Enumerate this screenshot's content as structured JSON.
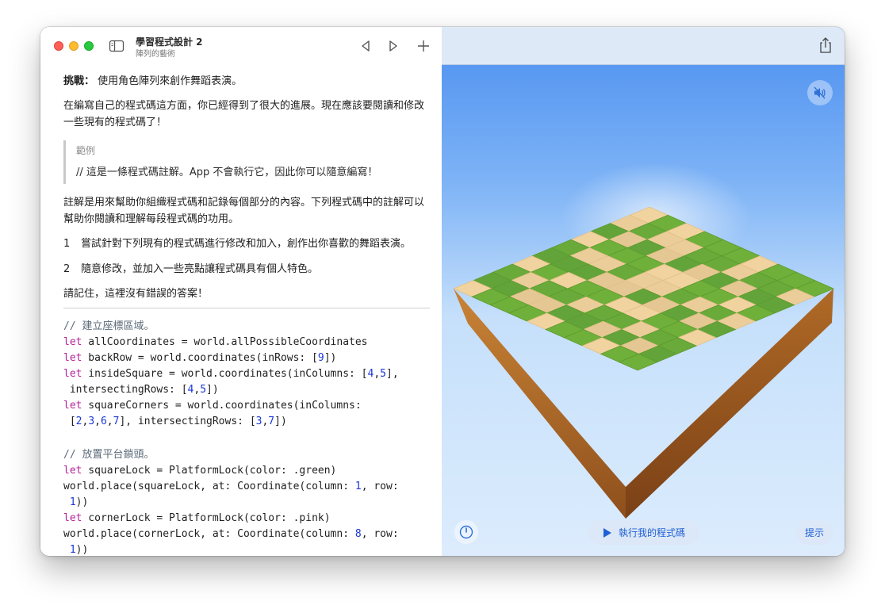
{
  "window": {
    "title": "學習程式設計 2",
    "subtitle": "陣列的藝術"
  },
  "instructions": {
    "challenge_label": "挑戰：",
    "challenge_text": " 使用角色陣列來創作舞蹈表演。",
    "intro": "在編寫自己的程式碼這方面，你已經得到了很大的進展。現在應該要閱讀和修改一些現有的程式碼了！",
    "example_label": "範例",
    "example_code": "//  這是一條程式碼註解。App  不會執行它，因此你可以隨意編寫！",
    "comment_explain": "註解是用來幫助你組織程式碼和記錄每個部分的內容。下列程式碼中的註解可以幫助你閱讀和理解每段程式碼的功用。",
    "steps": [
      {
        "num": "1",
        "text": "嘗試針對下列現有的程式碼進行修改和加入，創作出你喜歡的舞蹈表演。"
      },
      {
        "num": "2",
        "text": "隨意修改，並加入一些亮點讓程式碼具有個人特色。"
      }
    ],
    "reminder": "請記住，這裡沒有錯誤的答案！"
  },
  "code": {
    "comment1": "// 建立座標區域。",
    "let": "let",
    "line1": " allCoordinates = world.allPossibleCoordinates",
    "line2_a": " backRow = world.coordinates(inRows: [",
    "line2_n": "9",
    "line2_b": "])",
    "line3_a": " insideSquare = world.coordinates(inColumns: [",
    "line3_n1": "4",
    "line3_n2": "5",
    "line3_b": "],",
    "line4_a": " intersectingRows: [",
    "line4_n1": "4",
    "line4_n2": "5",
    "line4_b": "])",
    "line5": " squareCorners = world.coordinates(inColumns:",
    "line6_a": " [",
    "line6_n1": "2",
    "line6_n2": "3",
    "line6_n3": "6",
    "line6_n4": "7",
    "line6_b": "], intersectingRows: [",
    "line6_n5": "3",
    "line6_n6": "7",
    "line6_c": "])",
    "comment2": "// 放置平台鎖頭。",
    "line7": " squareLock = PlatformLock(color: .green)",
    "line8_a": "world.place(squareLock, at: Coordinate(column: ",
    "line8_n": "1",
    "line8_b": ", row:",
    "line9_n": "1",
    "line9_b": "))",
    "line10": " cornerLock = PlatformLock(color: .pink)",
    "line11_a": "world.place(cornerLock, at: Coordinate(column: ",
    "line11_n": "8",
    "line11_b": ", row:",
    "line12_n": "1",
    "line12_b": "))"
  },
  "controls": {
    "run_label": "執行我的程式碼",
    "hint_label": "提示"
  },
  "icons": {
    "sidebar": "sidebar-toggle-icon",
    "back": "chevron-left-icon",
    "forward": "chevron-right-icon",
    "add": "plus-icon",
    "share": "share-icon",
    "sound": "speaker-muted-icon",
    "speed": "speedometer-icon",
    "run": "play-icon"
  },
  "colors": {
    "keyword": "#b3239a",
    "number": "#1b36d6",
    "comment": "#5d6b7a",
    "accent": "#1f5fd6",
    "grass": "#6fb03a",
    "sand": "#f1d3a0",
    "dirt": "#b8712c"
  },
  "world": {
    "grid_size": 10,
    "sand_cells": [
      "0,0",
      "1,0",
      "0,2",
      "0,6",
      "1,2",
      "1,3",
      "1,6",
      "1,9",
      "2,1",
      "2,3",
      "2,5",
      "2,7",
      "3,0",
      "3,4",
      "3,5",
      "3,8",
      "4,1",
      "4,2",
      "4,4",
      "4,5",
      "4,7",
      "4,9",
      "5,3",
      "5,4",
      "5,6",
      "5,8",
      "6,0",
      "6,2",
      "6,5",
      "6,6",
      "6,9",
      "7,1",
      "7,4",
      "7,7",
      "8,2",
      "8,3",
      "8,6",
      "8,8",
      "9,0",
      "9,4",
      "9,7"
    ]
  }
}
